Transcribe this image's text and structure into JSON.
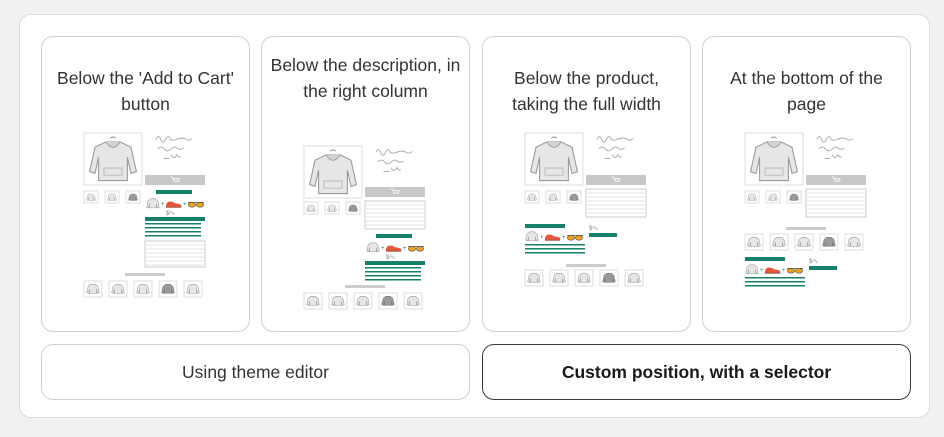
{
  "cards": [
    {
      "title": "Below the 'Add to Cart' button"
    },
    {
      "title": "Below the description, in the right column"
    },
    {
      "title": "Below the product, taking the full width"
    },
    {
      "title": "At the bottom of the page"
    }
  ],
  "buttons": {
    "theme_editor": "Using theme editor",
    "custom_position": "Custom position, with a selector"
  },
  "colors": {
    "accent": "#16806a",
    "shoe_red": "#e4583f",
    "glasses_orange": "#f0a21c"
  }
}
